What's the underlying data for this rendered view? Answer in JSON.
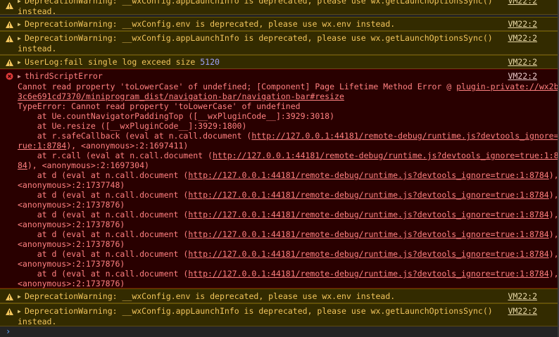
{
  "entries": [
    {
      "type": "warn",
      "lines": [
        "DeprecationWarning: __wxConfig.appLaunchInfo is deprecated, please use wx.getLaunchOptionsSync()",
        "instead."
      ],
      "source": "VM22:2"
    },
    {
      "type": "warn",
      "lines": [
        "DeprecationWarning: __wxConfig.env is deprecated, please use wx.env instead."
      ],
      "source": "VM22:2"
    },
    {
      "type": "warn",
      "lines": [
        "DeprecationWarning: __wxConfig.appLaunchInfo is deprecated, please use wx.getLaunchOptionsSync()",
        "instead."
      ],
      "source": "VM22:2"
    },
    {
      "type": "userlog",
      "prefix": "UserLog:fail single log exceed size ",
      "number": "5120",
      "source": "VM22:2"
    }
  ],
  "error": {
    "title": "thirdScriptError",
    "source": "VM22:2",
    "message_line1": "Cannot read property 'toLowerCase' of undefined; [Component] Page Lifetime Method Error @ ",
    "message_link1": "plugin-private://wx2b0",
    "message_link2": "3c6e691cd7370/miniprogram_dist/navigation-bar/navigation-bar#resize",
    "type_error": "TypeError: Cannot read property 'toLowerCase' of undefined",
    "stack1": "    at Ue.countNavigatorPaddingTop ([__wxPluginCode__]:3929:3018)",
    "stack2": "    at Ue.resize ([__wxPluginCode__]:3929:1800)",
    "stack3_pre": "    at r.safeCallback (eval at n.call.document (",
    "stack3_link": "http://127.0.0.1:44181/remote-debug/runtime.js?devtools_ignore=t",
    "stack3_link2": "rue:1:8784",
    "stack3_post": "), <anonymous>:2:1697411)",
    "stack4_pre": "    at r.call (eval at n.call.document (",
    "stack4_link": "http://127.0.0.1:44181/remote-debug/runtime.js?devtools_ignore=true:1:87",
    "stack4_link2": "84",
    "stack4_post": "), <anonymous>:2:1697304)",
    "d_pre": "    at d (eval at n.call.document (",
    "d_link": "http://127.0.0.1:44181/remote-debug/runtime.js?devtools_ignore=true:1:8784",
    "d_post": "),",
    "d_anon_first": "<anonymous>:2:1737748)",
    "d_anon": "<anonymous>:2:1737876)"
  },
  "tail_entries": [
    {
      "type": "warn",
      "lines": [
        "DeprecationWarning: __wxConfig.env is deprecated, please use wx.env instead."
      ],
      "source": "VM22:2"
    },
    {
      "type": "warn",
      "lines": [
        "DeprecationWarning: __wxConfig.appLaunchInfo is deprecated, please use wx.getLaunchOptionsSync()",
        "instead."
      ],
      "source": "VM22:2"
    }
  ],
  "prompt_symbol": "›",
  "colors": {
    "warn_bg": "#332b00",
    "warn_text": "#f2c55c",
    "error_bg": "#290000",
    "error_text": "#ff8080",
    "number": "#9ea4ff"
  },
  "icons": {
    "warning": "warning-triangle-icon",
    "error": "error-circle-icon",
    "expand": "expand-triangle-icon"
  }
}
